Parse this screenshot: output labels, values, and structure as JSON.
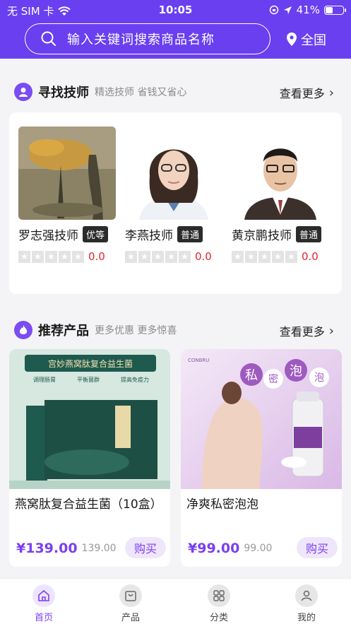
{
  "status_bar": {
    "carrier": "无 SIM 卡",
    "time": "10:05",
    "battery": "41%",
    "battery_level": 0.41
  },
  "search": {
    "placeholder": "输入关键词搜索商品名称"
  },
  "location": {
    "label": "全国"
  },
  "technicians_section": {
    "title": "寻找技师",
    "subtitle": "精选技师 省钱又省心",
    "more_label": "查看更多",
    "items": [
      {
        "name": "罗志强技师",
        "tag": "优等",
        "score": "0.0",
        "stars": 0
      },
      {
        "name": "李燕技师",
        "tag": "普通",
        "score": "0.0",
        "stars": 0
      },
      {
        "name": "黄京鹏技师",
        "tag": "普通",
        "score": "0.0",
        "stars": 0
      }
    ]
  },
  "products_section": {
    "title": "推荐产品",
    "subtitle": "更多优惠 更多惊喜",
    "more_label": "查看更多",
    "items": [
      {
        "title": "燕窝肽复合益生菌（10盒）",
        "price": "¥139.00",
        "original_price": "139.00",
        "buy_label": "购买",
        "image_text": {
          "banner": "宫妙燕窝肽复合益生菌",
          "features": [
            "调理肠胃",
            "平衡菌群",
            "提高免疫力"
          ]
        }
      },
      {
        "title": "净爽私密泡泡",
        "price": "¥99.00",
        "original_price": "99.00",
        "buy_label": "购买",
        "image_text": {
          "brand": "CONBRU",
          "headline": [
            "私",
            "密",
            "泡",
            "泡"
          ]
        }
      }
    ]
  },
  "bottom_nav": {
    "items": [
      {
        "label": "首页",
        "icon": "home-icon",
        "active": true
      },
      {
        "label": "产品",
        "icon": "bag-icon",
        "active": false
      },
      {
        "label": "分类",
        "icon": "grid-icon",
        "active": false
      },
      {
        "label": "我的",
        "icon": "user-icon",
        "active": false
      }
    ]
  },
  "colors": {
    "primary": "#6a3ff0",
    "accent": "#7b3ff2",
    "price_red": "#e0262b"
  }
}
